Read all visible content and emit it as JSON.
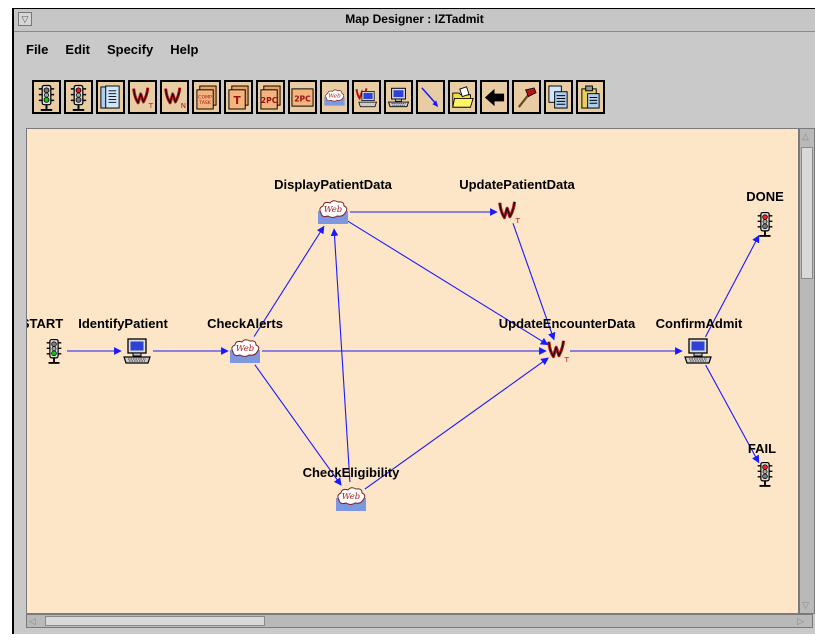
{
  "window": {
    "title": "Map Designer : IZTadmit"
  },
  "menu": [
    "File",
    "Edit",
    "Specify",
    "Help"
  ],
  "toolbar": [
    "green-light-icon",
    "red-light-icon",
    "document-list-icon",
    "workitem-t-icon",
    "workitem-nt-icon",
    "comp-task-icon",
    "task-t-icon",
    "two-pc-stack-icon",
    "two-pc-icon",
    "web-icon",
    "workstation-workitem-icon",
    "computer-icon",
    "connector-arrow-icon",
    "open-folder-icon",
    "back-arrow-icon",
    "hammer-icon",
    "copy-icon",
    "paste-icon"
  ],
  "toolbar_text": {
    "comp": "COMP TASK",
    "t": "T",
    "twopc": "2PC",
    "web": "Web",
    "nt": "NT"
  },
  "nodes": [
    {
      "id": "start",
      "label": "START",
      "type": "green-light"
    },
    {
      "id": "identify",
      "label": "IdentifyPatient",
      "type": "computer"
    },
    {
      "id": "alerts",
      "label": "CheckAlerts",
      "type": "web"
    },
    {
      "id": "display",
      "label": "DisplayPatientData",
      "type": "web"
    },
    {
      "id": "update",
      "label": "UpdatePatientData",
      "type": "workitem"
    },
    {
      "id": "encounter",
      "label": "UpdateEncounterData",
      "type": "workitem"
    },
    {
      "id": "confirm",
      "label": "ConfirmAdmit",
      "type": "computer"
    },
    {
      "id": "done",
      "label": "DONE",
      "type": "red-light"
    },
    {
      "id": "fail",
      "label": "FAIL",
      "type": "red-light"
    },
    {
      "id": "eligibility",
      "label": "CheckEligibility",
      "type": "web"
    }
  ],
  "edges": [
    [
      "start",
      "identify"
    ],
    [
      "identify",
      "alerts"
    ],
    [
      "alerts",
      "display"
    ],
    [
      "alerts",
      "encounter"
    ],
    [
      "alerts",
      "eligibility"
    ],
    [
      "display",
      "update"
    ],
    [
      "display",
      "encounter"
    ],
    [
      "update",
      "encounter"
    ],
    [
      "eligibility",
      "display"
    ],
    [
      "eligibility",
      "encounter"
    ],
    [
      "encounter",
      "confirm"
    ],
    [
      "confirm",
      "done"
    ],
    [
      "confirm",
      "fail"
    ]
  ],
  "icon_text": {
    "web": "Web",
    "t": "T"
  },
  "colors": {
    "canvas": "#fde5c8",
    "edge": "#1a1aff",
    "toolbar_button": "#e8cca4"
  }
}
